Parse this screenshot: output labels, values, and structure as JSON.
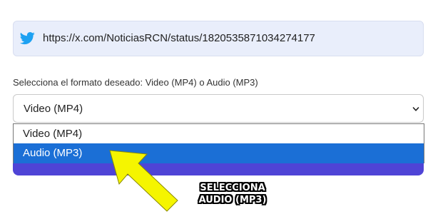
{
  "url_field": {
    "icon": "twitter-bird-icon",
    "value": "https://x.com/NoticiasRCN/status/1820535871034274177"
  },
  "format": {
    "label": "Selecciona el formato deseado: Video (MP4) o Audio (MP3)",
    "selected": "Video (MP4)",
    "options": [
      "Video (MP4)",
      "Audio (MP3)"
    ],
    "highlighted_option": "Audio (MP3)"
  },
  "annotation": {
    "line1": "SELECCIONA",
    "line2": "AUDIO (MP3)"
  },
  "colors": {
    "url_bg": "#e9eefb",
    "twitter_blue": "#1da1f2",
    "highlight": "#1b6fd6",
    "button": "#4f44d6",
    "arrow": "#f5f500"
  }
}
